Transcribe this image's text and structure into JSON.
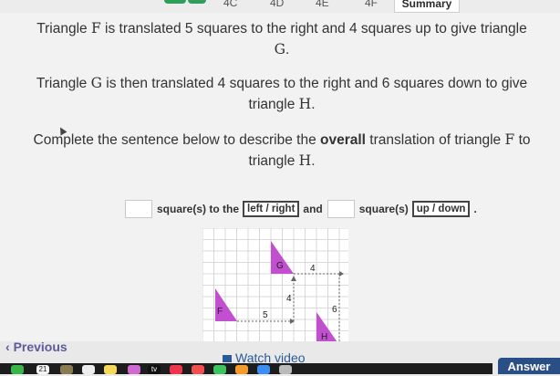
{
  "tabs": [
    {
      "label": "4C"
    },
    {
      "label": "4D"
    },
    {
      "label": "4E"
    },
    {
      "label": "4F"
    }
  ],
  "summary_tab": "Summary",
  "question": {
    "line1_a": "Triangle ",
    "line1_F": "F",
    "line1_b": " is translated 5 squares to the right and 4 squares up to give triangle",
    "line1_G": "G",
    "line1_end": ".",
    "line2_a": "Triangle ",
    "line2_G": "G",
    "line2_b": " is then translated 4 squares to the right and 6 squares down to give",
    "line2_c": "triangle ",
    "line2_H": "H",
    "line2_end": ".",
    "line3_a": "Complete the sentence below to describe the ",
    "line3_bold": "overall",
    "line3_b": " translation of triangle ",
    "line3_F": "F",
    "line3_c": " to",
    "line3_d": "triangle ",
    "line3_H": "H",
    "line3_end": "."
  },
  "answer_sentence": {
    "part1": "square(s) to the",
    "choice1": "left / right",
    "part2": "and",
    "part3": "square(s)",
    "choice2": "up / down",
    "end": "."
  },
  "diagram": {
    "label_G": "G",
    "label_F": "F",
    "label_H": "H",
    "label_4_top": "4",
    "label_4_vert": "4",
    "label_5": "5",
    "label_6": "6",
    "color_triangle": "#c24fd0",
    "color_grid": "#cfcfcf"
  },
  "nav": {
    "previous": "Previous",
    "watch_video": "Watch video",
    "answer": "Answer"
  },
  "dock": {
    "calendar_day": "21",
    "tv_label": "tv"
  }
}
